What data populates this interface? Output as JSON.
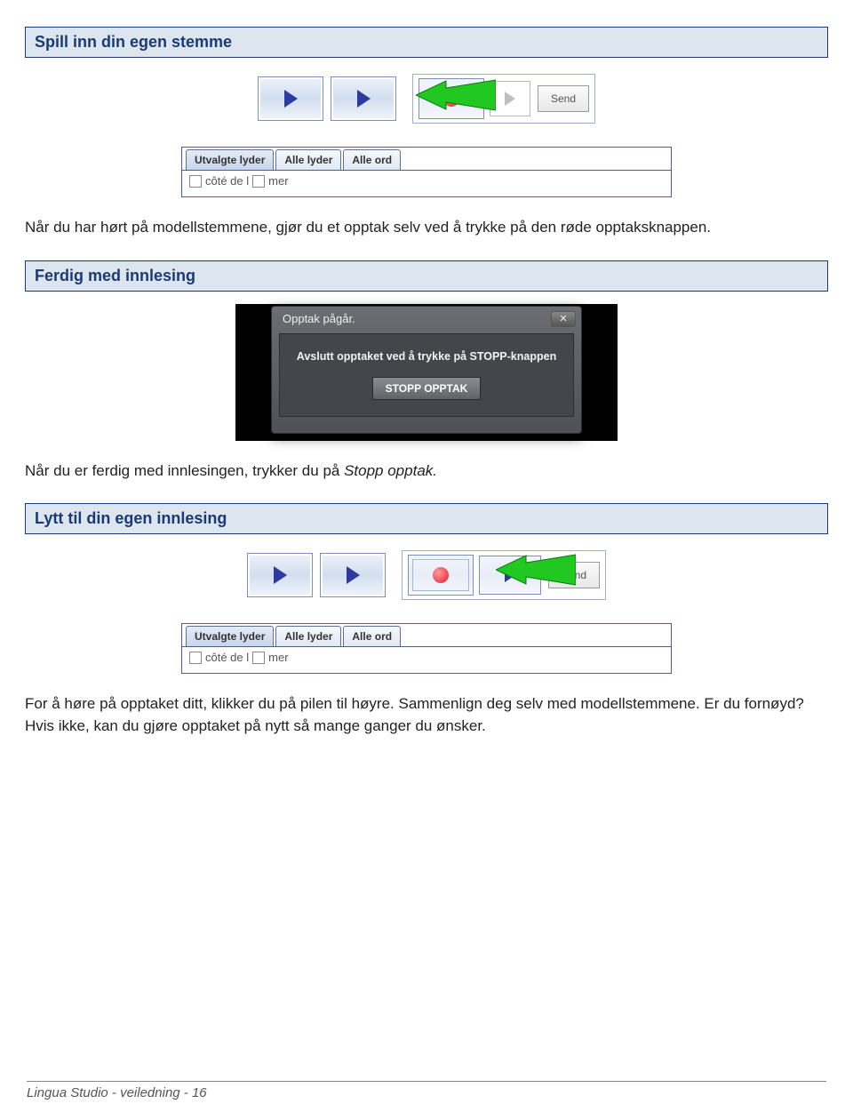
{
  "sections": {
    "s1": {
      "title": "Spill inn din egen stemme"
    },
    "s2": {
      "title": "Ferdig med innlesing"
    },
    "s3": {
      "title": "Lytt til din egen innlesing"
    }
  },
  "text": {
    "p1": "Når du har hørt på modellstemmene, gjør du et opptak selv ved å trykke på den røde opptaksknappen.",
    "p2a": "Når du er ferdig med innlesingen, trykker du på ",
    "p2b": "Stopp opptak.",
    "p3": "For å høre på opptaket ditt, klikker du på pilen til høyre. Sammenlign deg selv med modellstemmene. Er du fornøyd? Hvis ikke, kan du gjøre opptaket på nytt så mange ganger du ønsker."
  },
  "ui": {
    "send": "Send",
    "tabs": {
      "t1": "Utvalgte lyder",
      "t2": "Alle lyder",
      "t3": "Alle ord"
    },
    "line1a": "côté  de  l",
    "line1b": "mer"
  },
  "dialog": {
    "title": "Opptak pågår.",
    "msg": "Avslutt opptaket ved å trykke på STOPP-knappen",
    "btn": "STOPP OPPTAK"
  },
  "footer": "Lingua Studio - veiledning - 16"
}
